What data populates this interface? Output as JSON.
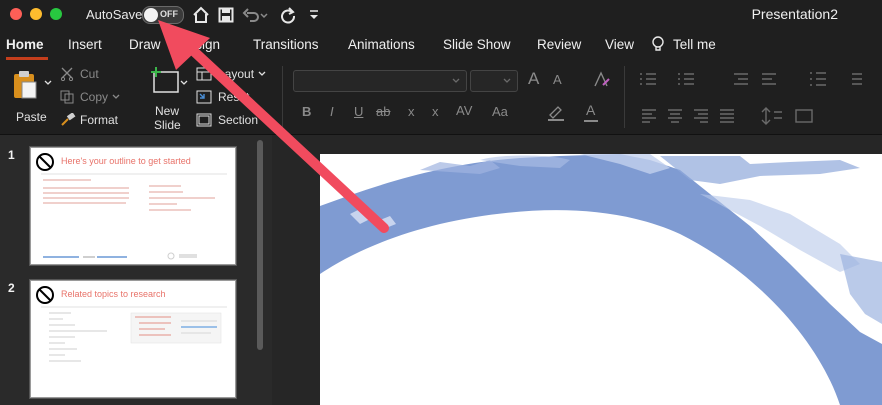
{
  "window": {
    "autosave_label": "AutoSave",
    "autosave_state": "OFF",
    "doc_title": "Presentation2"
  },
  "tabs": [
    "Home",
    "Insert",
    "Draw",
    "Design",
    "Transitions",
    "Animations",
    "Slide Show",
    "Review",
    "View"
  ],
  "tell_me": "Tell me",
  "ribbon": {
    "paste": "Paste",
    "cut": "Cut",
    "copy": "Copy",
    "format": "Format",
    "new_slide_line1": "New",
    "new_slide_line2": "Slide",
    "layout": "Layout",
    "reset": "Reset",
    "section": "Section",
    "font_a_big": "A",
    "font_a_small": "A",
    "bold": "B",
    "italic": "I",
    "underline": "U",
    "strike": "ab",
    "superscript": "x",
    "subscript": "x",
    "char_spacing": "AV",
    "change_case": "Aa",
    "font_color": "A"
  },
  "slides": [
    {
      "number": "1",
      "title": "Here's your outline to get started"
    },
    {
      "number": "2",
      "title": "Related topics to research"
    }
  ],
  "colors": {
    "accent_red": "#c43e1c",
    "arrow_red": "#f14b5e",
    "blue_shape": "#7f9bd2"
  },
  "icons": [
    "home-icon",
    "save-icon",
    "undo-icon",
    "redo-icon",
    "customize-icon",
    "lightbulb-icon",
    "no-symbol-icon"
  ]
}
